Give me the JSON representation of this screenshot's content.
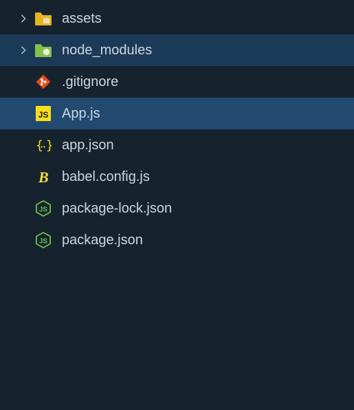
{
  "tree": {
    "items": [
      {
        "type": "folder",
        "label": "assets",
        "expanded": false,
        "selected": false,
        "icon": "folder-assets-icon"
      },
      {
        "type": "folder",
        "label": "node_modules",
        "expanded": false,
        "selected": "hover",
        "icon": "folder-nodemodules-icon"
      },
      {
        "type": "file",
        "label": ".gitignore",
        "selected": false,
        "icon": "git-icon"
      },
      {
        "type": "file",
        "label": "App.js",
        "selected": "active",
        "icon": "js-icon"
      },
      {
        "type": "file",
        "label": "app.json",
        "selected": false,
        "icon": "json-icon"
      },
      {
        "type": "file",
        "label": "babel.config.js",
        "selected": false,
        "icon": "babel-icon"
      },
      {
        "type": "file",
        "label": "package-lock.json",
        "selected": false,
        "icon": "nodejs-icon"
      },
      {
        "type": "file",
        "label": "package.json",
        "selected": false,
        "icon": "nodejs-icon"
      }
    ]
  },
  "colors": {
    "bg": "#16232f",
    "row_hover": "#1b3a57",
    "row_active": "#224a70",
    "text": "#cdd6df",
    "js_yellow": "#f7df1e",
    "babel_yellow": "#f9dc3e",
    "git_orange": "#e64a19",
    "node_green": "#6cc24a",
    "folder_yellow": "#e6b422",
    "folder_green": "#8ac04a"
  }
}
